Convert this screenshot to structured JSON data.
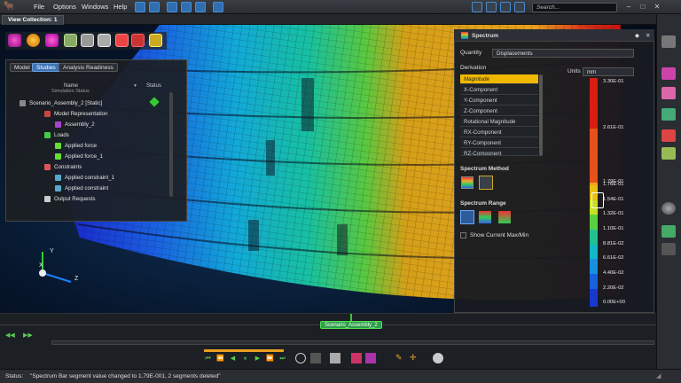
{
  "menu": {
    "file": "File",
    "options": "Options",
    "windows": "Windows",
    "help": "Help"
  },
  "search": {
    "placeholder": "Search..."
  },
  "tabs": {
    "view_collection": "View Collection: 1"
  },
  "studies": {
    "tabs": [
      "Model",
      "Studies",
      "Analysis Readiness"
    ],
    "col_name": "Name",
    "col_status": "Status",
    "items": [
      {
        "label": "Simulation Status"
      },
      {
        "label": "Scenario_Assembly_2 [Static]"
      },
      {
        "label": "Model Representation"
      },
      {
        "label": "Assembly_2"
      },
      {
        "label": "Loads"
      },
      {
        "label": "Applied force"
      },
      {
        "label": "Applied force_1"
      },
      {
        "label": "Constraints"
      },
      {
        "label": "Applied constraint_1"
      },
      {
        "label": "Applied constraint"
      },
      {
        "label": "Output Requests"
      }
    ]
  },
  "spectrum": {
    "title": "Spectrum",
    "quantity_label": "Quantity",
    "quantity_value": "Displacements",
    "derivation_label": "Derivation",
    "units_label": "Units",
    "units_value": "mm",
    "derivations": [
      "Magnitude",
      "X-Component",
      "Y-Component",
      "Z-Component",
      "Rotational Magnitude",
      "RX-Component",
      "RY-Component",
      "RZ-Component"
    ],
    "method_label": "Spectrum Method",
    "range_label": "Spectrum Range",
    "show_minmax": "Show Current Max/Min",
    "labels": [
      "3.30E-01",
      "2.61E-01",
      "1.79E-01",
      "1.76E-01",
      "1.54E-01",
      "1.32E-01",
      "1.10E-01",
      "8.81E-02",
      "6.61E-02",
      "4.40E-02",
      "2.20E-02",
      "0.00E+00"
    ],
    "colors": [
      "#d81e12",
      "#e8501a",
      "#f0a020",
      "#e8c010",
      "#c8e020",
      "#5ad040",
      "#20c090",
      "#10b8c8",
      "#1890e0",
      "#1860e0",
      "#1838d0",
      "#1414b8"
    ]
  },
  "axes": {
    "x": "X",
    "y": "Y",
    "z": "Z"
  },
  "timeline": {
    "scenario": "Scenario_Assembly_2"
  },
  "status": {
    "label": "Status:",
    "text": "\"Spectrum Bar segment value changed to 1.79E-001, 2 segments deleted\""
  }
}
